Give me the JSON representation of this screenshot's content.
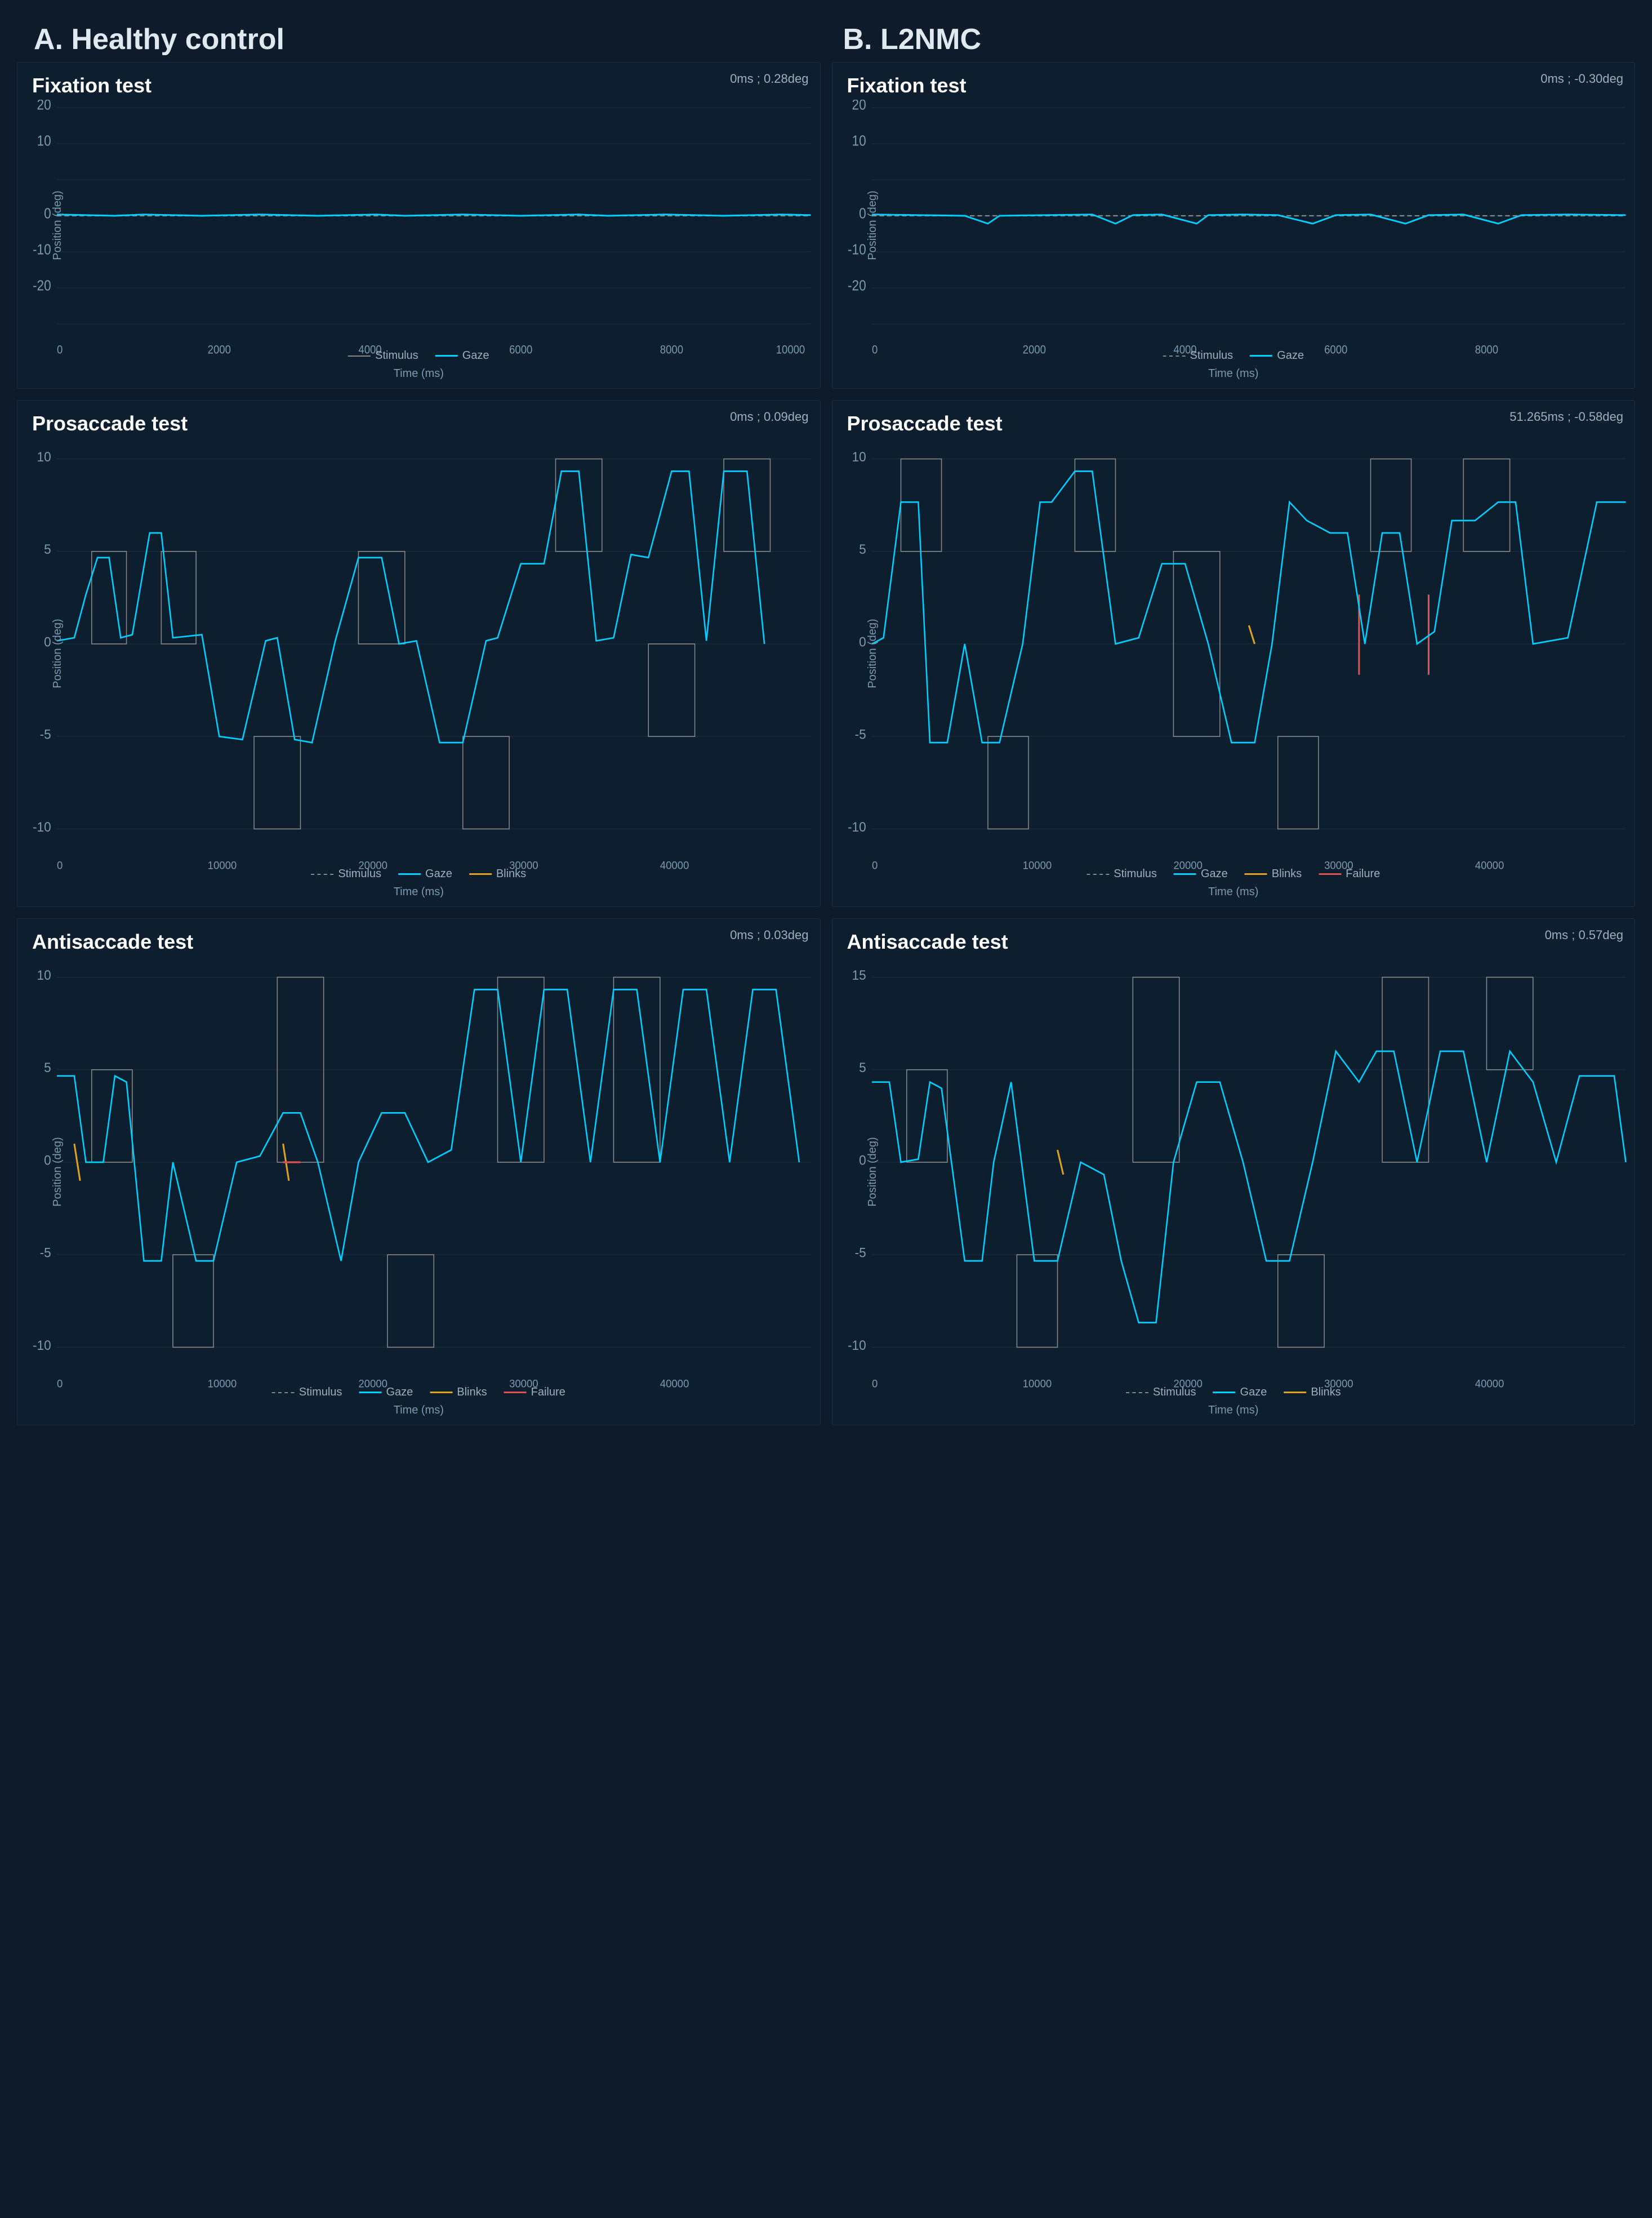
{
  "headers": {
    "left": "A. Healthy control",
    "right": "B. L2NMC"
  },
  "panels": {
    "fixation_left": {
      "title": "Fixation test",
      "cursor_info": "0ms ; 0.28deg",
      "y_label": "Position (deg)",
      "x_label": "Time (ms)",
      "legend": [
        {
          "label": "Stimulus",
          "color": "#888888"
        },
        {
          "label": "Gaze",
          "color": "#00cfff"
        }
      ]
    },
    "fixation_right": {
      "title": "Fixation test",
      "cursor_info": "0ms ; -0.30deg",
      "y_label": "Position (deg)",
      "x_label": "Time (ms)",
      "legend": [
        {
          "label": "Stimulus",
          "color": "#888888"
        },
        {
          "label": "Gaze",
          "color": "#00cfff"
        }
      ]
    },
    "prosaccade_left": {
      "title": "Prosaccade test",
      "cursor_info": "0ms ; 0.09deg",
      "y_label": "Position (deg)",
      "x_label": "Time (ms)",
      "legend": [
        {
          "label": "Stimulus",
          "color": "#888888"
        },
        {
          "label": "Gaze",
          "color": "#00cfff"
        },
        {
          "label": "Blinks",
          "color": "#e0a020"
        }
      ]
    },
    "prosaccade_right": {
      "title": "Prosaccade test",
      "cursor_info": "51.265ms ; -0.58deg",
      "y_label": "Position (deg)",
      "x_label": "Time (ms)",
      "legend": [
        {
          "label": "Stimulus",
          "color": "#888888"
        },
        {
          "label": "Gaze",
          "color": "#00cfff"
        },
        {
          "label": "Blinks",
          "color": "#e0a020"
        },
        {
          "label": "Failure",
          "color": "#e05050"
        }
      ]
    },
    "antisaccade_left": {
      "title": "Antisaccade test",
      "cursor_info": "0ms ; 0.03deg",
      "y_label": "Position (deg)",
      "x_label": "Time (ms)",
      "legend": [
        {
          "label": "Stimulus",
          "color": "#888888"
        },
        {
          "label": "Gaze",
          "color": "#00cfff"
        },
        {
          "label": "Blinks",
          "color": "#e0a020"
        },
        {
          "label": "Failure",
          "color": "#e05050"
        }
      ]
    },
    "antisaccade_right": {
      "title": "Antisaccade test",
      "cursor_info": "0ms ; 0.57deg",
      "y_label": "Position (deg)",
      "x_label": "Time (ms)",
      "legend": [
        {
          "label": "Stimulus",
          "color": "#888888"
        },
        {
          "label": "Gaze",
          "color": "#00cfff"
        },
        {
          "label": "Blinks",
          "color": "#e0a020"
        }
      ]
    }
  }
}
